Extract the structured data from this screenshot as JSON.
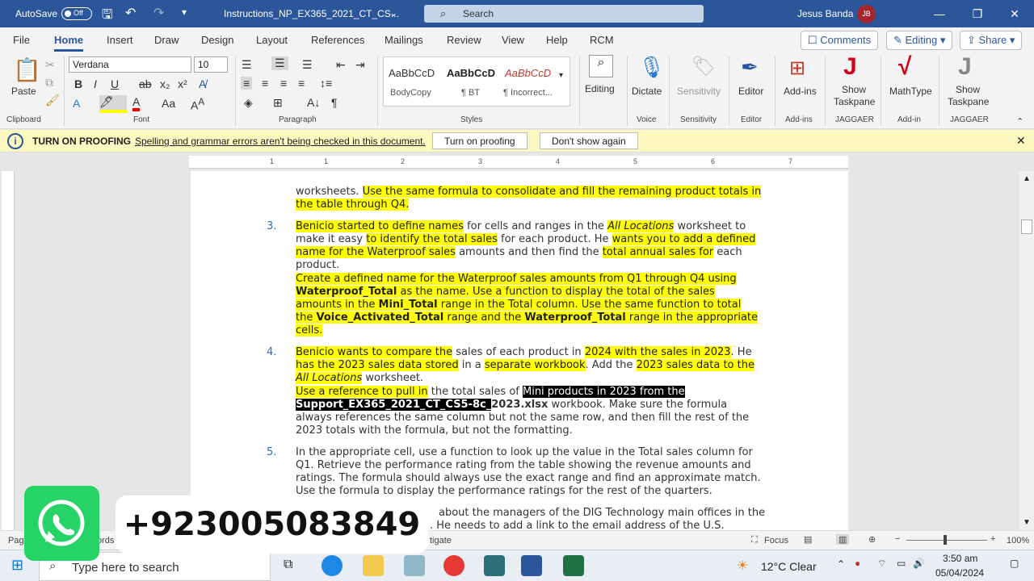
{
  "titlebar": {
    "autosave_label": "AutoSave",
    "autosave_state": "Off",
    "document_title": "Instructions_NP_EX365_2021_CT_CS...",
    "search_placeholder": "Search",
    "user_name": "Jesus Banda",
    "user_initials": "JB",
    "minimize": "—",
    "restore": "❐",
    "close": "✕"
  },
  "tabs": [
    "File",
    "Home",
    "Insert",
    "Draw",
    "Design",
    "Layout",
    "References",
    "Mailings",
    "Review",
    "View",
    "Help",
    "RCM"
  ],
  "tab_buttons": {
    "comments": "Comments",
    "editing": "Editing",
    "share": "Share"
  },
  "ribbon": {
    "paste": "Paste",
    "font_name": "Verdana",
    "font_size": "10",
    "styles": [
      {
        "preview": "AaBbCcD",
        "name": "BodyCopy"
      },
      {
        "preview": "AaBbCcD",
        "name": "¶ BT"
      },
      {
        "preview": "AaBbCcD",
        "name": "¶ Incorrect..."
      }
    ],
    "editing": "Editing",
    "dictate": "Dictate",
    "sensitivity": "Sensitivity",
    "editor": "Editor",
    "addins": "Add-ins",
    "show_taskpane": "Show Taskpane",
    "mathtype": "MathType",
    "show_taskpane2": "Show Taskpane",
    "groups": [
      "Clipboard",
      "Font",
      "Paragraph",
      "Styles",
      "Voice",
      "Sensitivity",
      "Editor",
      "Add-ins",
      "JAGGAER",
      "Add-in",
      "JAGGAER"
    ]
  },
  "notification": {
    "title": "TURN ON PROOFING",
    "message": "Spelling and grammar errors aren't being checked in this document.",
    "btn_turn_on": "Turn on proofing",
    "btn_dont_show": "Don't show again"
  },
  "ruler_ticks": [
    "1",
    "1",
    "2",
    "3",
    "4",
    "5",
    "6",
    "7"
  ],
  "document": {
    "lines": [
      {
        "num": "",
        "parts": [
          {
            "t": "worksheets. ",
            "h": false
          },
          {
            "t": "Use the same formula to consolidate and fill the remaining product totals in",
            "h": true
          }
        ]
      },
      {
        "num": "",
        "parts": [
          {
            "t": "the table through Q4.",
            "h": true
          }
        ]
      },
      {
        "num": "3.",
        "parts": [
          {
            "t": "Benicio started to define names",
            "h": true
          },
          {
            "t": " for cells and ranges in the ",
            "h": false
          },
          {
            "t": "All Locations",
            "h": true,
            "i": true
          },
          {
            "t": " worksheet to",
            "h": false
          }
        ]
      },
      {
        "num": "",
        "parts": [
          {
            "t": "make it easy ",
            "h": false
          },
          {
            "t": "to identify the total sales",
            "h": true
          },
          {
            "t": " for each product. He ",
            "h": false
          },
          {
            "t": "wants you to add a defined",
            "h": true
          }
        ]
      },
      {
        "num": "",
        "parts": [
          {
            "t": "name for the Waterproof sales",
            "h": true
          },
          {
            "t": " amounts and then find the ",
            "h": false
          },
          {
            "t": "total annual sales for",
            "h": true
          },
          {
            "t": " each",
            "h": false
          }
        ]
      },
      {
        "num": "",
        "parts": [
          {
            "t": "product.",
            "h": false
          }
        ]
      },
      {
        "num": "",
        "parts": [
          {
            "t": "Create a defined name for the Waterproof sales amounts from Q1 through Q4 using",
            "h": true
          }
        ]
      },
      {
        "num": "",
        "parts": [
          {
            "t": "Waterproof_Total",
            "h": true,
            "b": true
          },
          {
            "t": " as the name. Use a ",
            "h": true
          },
          {
            "t": "function to display the total of the sales",
            "h": true
          }
        ]
      },
      {
        "num": "",
        "parts": [
          {
            "t": "amounts in the ",
            "h": true
          },
          {
            "t": "Mini_Total",
            "h": true,
            "b": true
          },
          {
            "t": " range in the Total column. Use the same function to total",
            "h": true
          }
        ]
      },
      {
        "num": "",
        "parts": [
          {
            "t": "the ",
            "h": true
          },
          {
            "t": "Voice_Activated_Total",
            "h": true,
            "b": true
          },
          {
            "t": " range and the ",
            "h": true
          },
          {
            "t": "Waterproof_Total",
            "h": true,
            "b": true
          },
          {
            "t": " range in the appropriate",
            "h": true
          }
        ]
      },
      {
        "num": "",
        "parts": [
          {
            "t": "cells.",
            "h": true
          }
        ]
      },
      {
        "num": "4.",
        "parts": [
          {
            "t": "Benicio wants to compare the",
            "h": true
          },
          {
            "t": " sales of each product in ",
            "h": false
          },
          {
            "t": "2024 with the sales in 2023",
            "h": true
          },
          {
            "t": ". He",
            "h": false
          }
        ]
      },
      {
        "num": "",
        "parts": [
          {
            "t": "has the 2023 sales data stored",
            "h": true
          },
          {
            "t": " in a ",
            "h": false
          },
          {
            "t": "separate workbook",
            "h": true
          },
          {
            "t": ". Add the ",
            "h": false
          },
          {
            "t": "2023 sales data to the",
            "h": true
          }
        ]
      },
      {
        "num": "",
        "parts": [
          {
            "t": "All Locations",
            "h": true,
            "i": true
          },
          {
            "t": " worksheet.",
            "h": false
          }
        ]
      },
      {
        "num": "",
        "parts": [
          {
            "t": "Use a reference to pull in",
            "h": true
          },
          {
            "t": " the total sales of ",
            "h": false
          },
          {
            "t": "Mini products in 2023 from the ",
            "h": false,
            "s": true
          }
        ]
      },
      {
        "num": "",
        "parts": [
          {
            "t": "Support_EX365_2021_CT_CS5-8c_",
            "h": false,
            "s": true,
            "b": true
          },
          {
            "t": "2023.xlsx",
            "h": false,
            "b": true
          },
          {
            "t": " workbook. Make sure the formula",
            "h": false
          }
        ]
      },
      {
        "num": "",
        "parts": [
          {
            "t": "always references the same column but not the same row, and then fill the rest of the",
            "h": false
          }
        ]
      },
      {
        "num": "",
        "parts": [
          {
            "t": "2023 totals with the formula, but not the formatting.",
            "h": false
          }
        ]
      },
      {
        "num": "5.",
        "parts": [
          {
            "t": "In the appropriate cell, use a function to look up the value in the Total sales column for",
            "h": false
          }
        ]
      },
      {
        "num": "",
        "parts": [
          {
            "t": "Q1. Retrieve the performance rating from the table showing the revenue amounts and",
            "h": false
          }
        ]
      },
      {
        "num": "",
        "parts": [
          {
            "t": "ratings. The formula should always use the exact range and find an approximate match.",
            "h": false
          }
        ]
      },
      {
        "num": "",
        "parts": [
          {
            "t": "Use the formula to display the performance ratings for the rest of the quarters.",
            "h": false
          }
        ]
      },
      {
        "num": "",
        "parts": [
          {
            "t": "about the managers of the DIG Technology main offices in the",
            "h": false
          }
        ]
      },
      {
        "num": "",
        "parts": [
          {
            "t": ". He needs to add a link to the email address of the U.S.",
            "h": false
          }
        ]
      }
    ]
  },
  "status": {
    "page": "Page",
    "words": "ords",
    "navigate": "tigate",
    "focus": "Focus",
    "zoom": "100%"
  },
  "taskbar": {
    "search_placeholder": "Type here to search",
    "weather": "12°C  Clear",
    "time": "3:50 am",
    "date": "05/04/2024"
  },
  "overlay": {
    "phone": "+923005083849"
  },
  "colors": {
    "word_blue": "#2b579a",
    "highlight": "#ffff00",
    "whatsapp": "#25d366"
  }
}
